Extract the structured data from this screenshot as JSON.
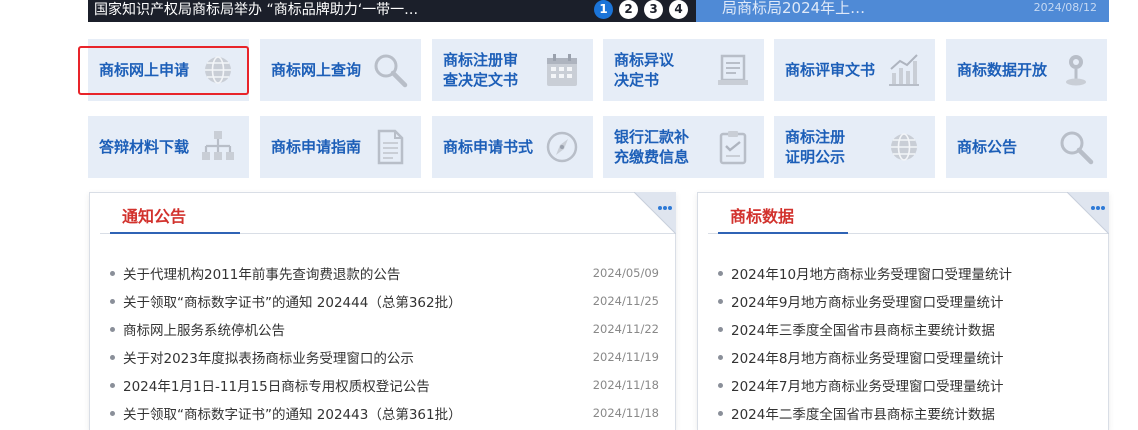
{
  "banner": {
    "caption": "国家知识产权局商标局举办 “商标品牌助力‘一带一…",
    "dots": [
      "1",
      "2",
      "3",
      "4"
    ],
    "active_dot": 0
  },
  "news_strip": {
    "title": "局商标局2024年上…",
    "date": "2024/08/12"
  },
  "tiles": [
    {
      "label": "商标网上申请",
      "icon": "globe-icon"
    },
    {
      "label": "商标网上查询",
      "icon": "magnifier-icon"
    },
    {
      "label": "商标注册审\n查决定文书",
      "icon": "calendar-icon"
    },
    {
      "label": "商标异议\n决定书",
      "icon": "document-tray-icon"
    },
    {
      "label": "商标评审文书",
      "icon": "bar-chart-icon"
    },
    {
      "label": "商标数据开放",
      "icon": "map-pin-icon"
    },
    {
      "label": "答辩材料下载",
      "icon": "sitemap-icon"
    },
    {
      "label": "商标申请指南",
      "icon": "document-icon"
    },
    {
      "label": "商标申请书式",
      "icon": "compass-icon"
    },
    {
      "label": "银行汇款补\n充缴费信息",
      "icon": "clipboard-icon"
    },
    {
      "label": "商标注册\n证明公示",
      "icon": "globe-icon"
    },
    {
      "label": "商标公告",
      "icon": "magnifier-icon"
    }
  ],
  "notice_panel": {
    "title": "通知公告",
    "items": [
      {
        "title": "关于代理机构2011年前事先查询费退款的公告",
        "date": "2024/05/09"
      },
      {
        "title": "关于领取“商标数字证书”的通知 202444（总第362批）",
        "date": "2024/11/25"
      },
      {
        "title": "商标网上服务系统停机公告",
        "date": "2024/11/22"
      },
      {
        "title": "关于对2023年度拟表扬商标业务受理窗口的公示",
        "date": "2024/11/19"
      },
      {
        "title": "2024年1月1日-11月15日商标专用权质权登记公告",
        "date": "2024/11/18"
      },
      {
        "title": "关于领取“商标数字证书”的通知 202443（总第361批）",
        "date": "2024/11/18"
      }
    ]
  },
  "data_panel": {
    "title": "商标数据",
    "items": [
      {
        "title": "2024年10月地方商标业务受理窗口受理量统计"
      },
      {
        "title": "2024年9月地方商标业务受理窗口受理量统计"
      },
      {
        "title": "2024年三季度全国省市县商标主要统计数据"
      },
      {
        "title": "2024年8月地方商标业务受理窗口受理量统计"
      },
      {
        "title": "2024年7月地方商标业务受理窗口受理量统计"
      },
      {
        "title": "2024年二季度全国省市县商标主要统计数据"
      }
    ]
  },
  "colors": {
    "tile_bg": "#e6edf7",
    "tile_text": "#1d5fb8",
    "panel_title": "#d2322d",
    "highlight": "#e8242a",
    "banner_active": "#1b74d8"
  }
}
